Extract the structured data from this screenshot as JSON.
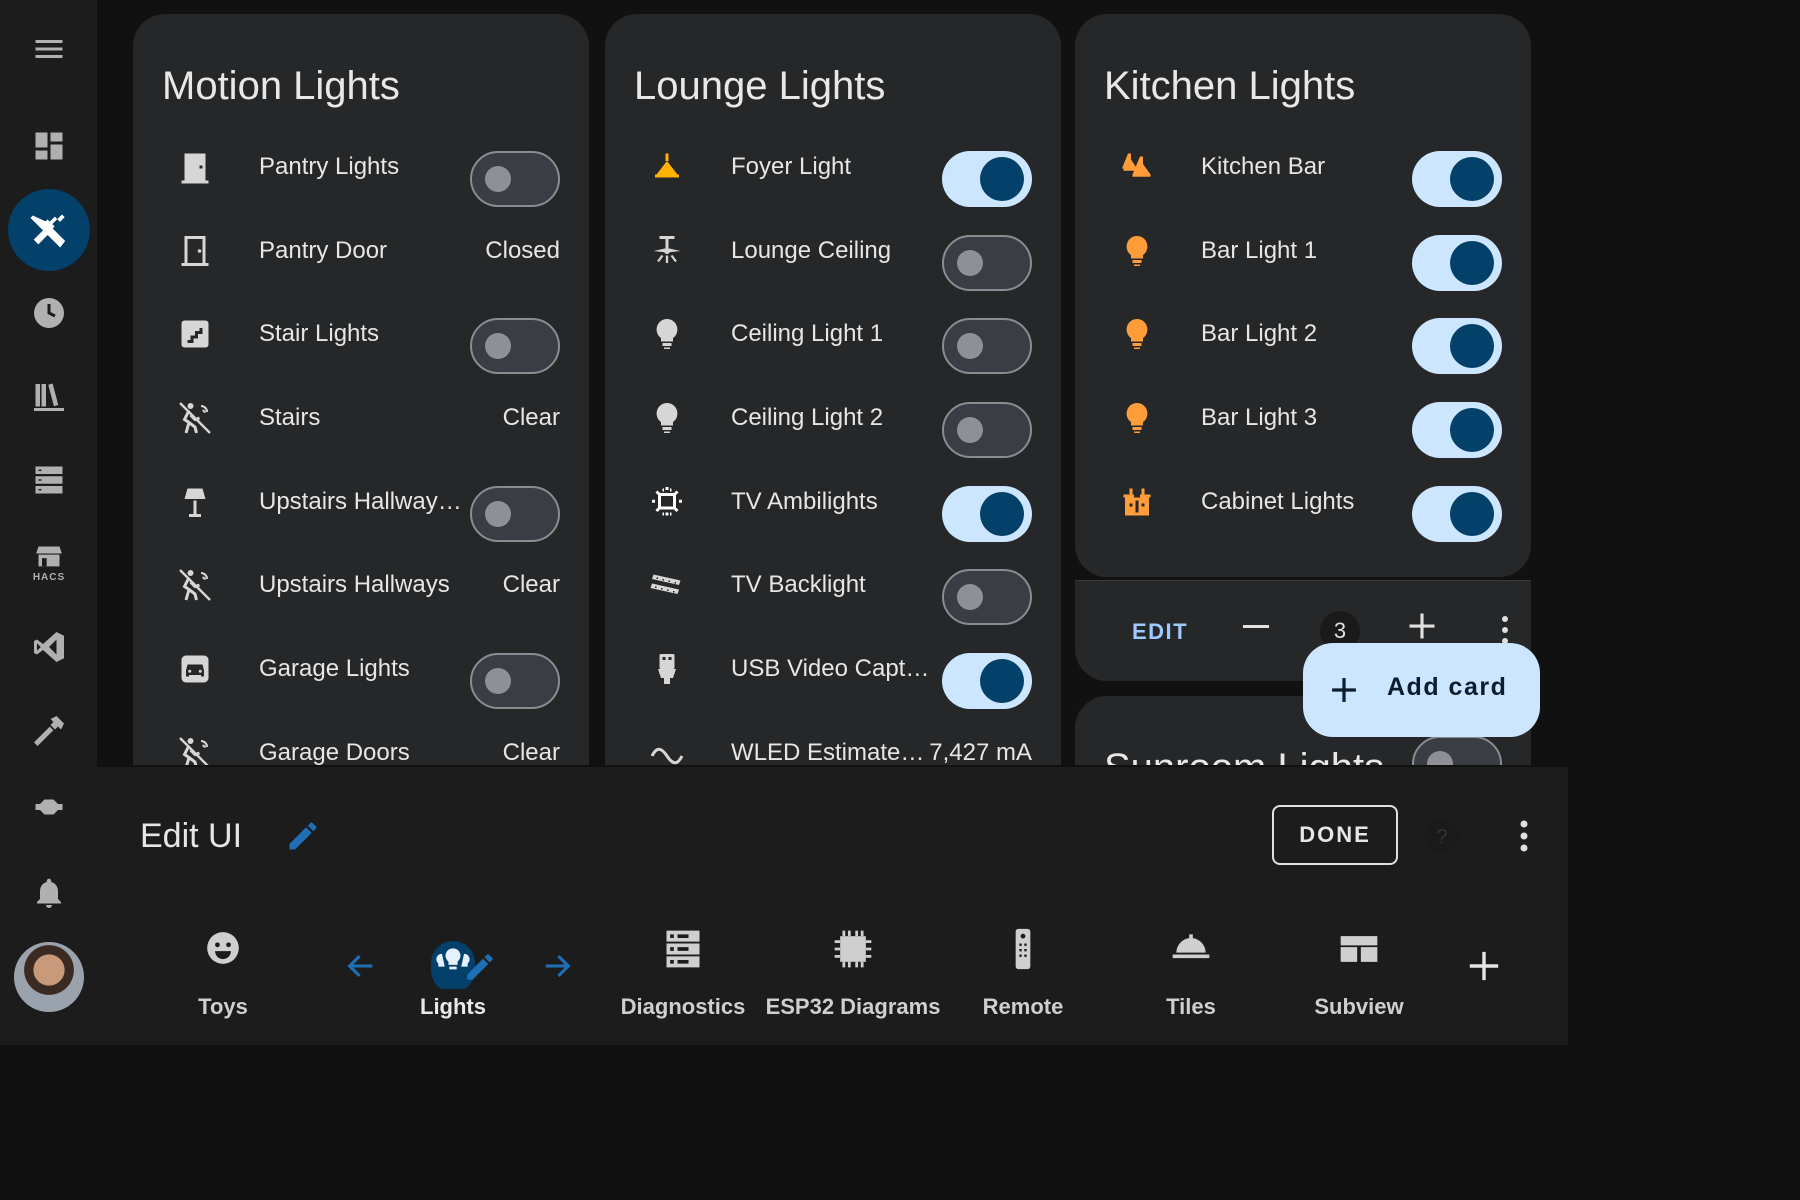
{
  "colors": {
    "accent": "#03406a",
    "accent_light": "#cde6ff",
    "amber": "#ffb300",
    "orange": "#ff9d3a",
    "link": "#9fcaff"
  },
  "sidebar": {
    "items": [
      {
        "icon": "menu-icon"
      },
      {
        "icon": "dashboard-icon"
      },
      {
        "icon": "tools-icon",
        "active": true
      },
      {
        "icon": "history-icon"
      },
      {
        "icon": "library-icon"
      },
      {
        "icon": "list-icon"
      },
      {
        "icon": "hacs-icon",
        "label": "HACS"
      },
      {
        "icon": "vscode-icon"
      },
      {
        "icon": "hammer-icon"
      },
      {
        "icon": "ha-remote-icon"
      },
      {
        "icon": "bell-icon"
      }
    ]
  },
  "cards": {
    "motion": {
      "title": "Motion Lights",
      "rows": [
        {
          "icon": "door-closed-icon",
          "label": "Pantry Lights",
          "toggle": "off"
        },
        {
          "icon": "door-icon",
          "label": "Pantry Door",
          "state": "Closed"
        },
        {
          "icon": "stairs-icon",
          "label": "Stair Lights",
          "toggle": "off"
        },
        {
          "icon": "motion-sensor-off-icon",
          "label": "Stairs",
          "state": "Clear"
        },
        {
          "icon": "floor-lamp-icon",
          "label": "Upstairs Hallway…",
          "toggle": "off"
        },
        {
          "icon": "motion-sensor-off-icon",
          "label": "Upstairs Hallways",
          "state": "Clear"
        },
        {
          "icon": "garage-icon",
          "label": "Garage Lights",
          "toggle": "off"
        },
        {
          "icon": "motion-sensor-off-icon",
          "label": "Garage Doors",
          "state": "Clear"
        }
      ]
    },
    "lounge": {
      "title": "Lounge Lights",
      "rows": [
        {
          "icon": "ceiling-light-icon",
          "label": "Foyer Light",
          "toggle": "on"
        },
        {
          "icon": "ceiling-fan-icon",
          "label": "Lounge Ceiling",
          "toggle": "off"
        },
        {
          "icon": "bulb-icon",
          "label": "Ceiling Light 1",
          "toggle": "off"
        },
        {
          "icon": "bulb-icon",
          "label": "Ceiling Light 2",
          "toggle": "off"
        },
        {
          "icon": "tv-ambilight-icon",
          "label": "TV Ambilights",
          "toggle": "on"
        },
        {
          "icon": "led-strip-icon",
          "label": "TV Backlight",
          "toggle": "off"
        },
        {
          "icon": "usb-icon",
          "label": "USB Video Capt…",
          "toggle": "on"
        },
        {
          "icon": "current-ac-icon",
          "label": "WLED Estimate…",
          "state": "7,427 mA"
        }
      ]
    },
    "kitchen": {
      "title": "Kitchen Lights",
      "rows": [
        {
          "icon": "pendant-light-icon",
          "label": "Kitchen Bar",
          "toggle": "on"
        },
        {
          "icon": "bulb-icon",
          "label": "Bar Light 1",
          "toggle": "on"
        },
        {
          "icon": "bulb-icon",
          "label": "Bar Light 2",
          "toggle": "on"
        },
        {
          "icon": "bulb-icon",
          "label": "Bar Light 3",
          "toggle": "on"
        },
        {
          "icon": "cabinet-light-icon",
          "label": "Cabinet Lights",
          "toggle": "on"
        }
      ]
    },
    "sunroom": {
      "title": "Sunroom Lights",
      "toggle": "off"
    }
  },
  "editbar": {
    "edit_label": "EDIT",
    "count": "3"
  },
  "fab": {
    "label": "Add card"
  },
  "editui": {
    "title": "Edit UI",
    "done_label": "DONE",
    "tabs": [
      {
        "icon": "emoticon-icon",
        "label": "Toys"
      },
      {
        "icon": "lightbulb-group-icon",
        "label": "Lights",
        "active": true
      },
      {
        "icon": "server-icon",
        "label": "Diagnostics"
      },
      {
        "icon": "chip-icon",
        "label": "ESP32 Diagrams"
      },
      {
        "icon": "remote-icon",
        "label": "Remote"
      },
      {
        "icon": "dome-light-icon",
        "label": "Tiles"
      },
      {
        "icon": "view-dashboard-icon",
        "label": "Subview"
      }
    ]
  }
}
